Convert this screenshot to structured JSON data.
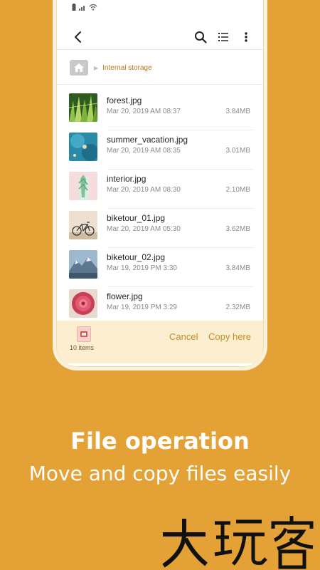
{
  "breadcrumb": {
    "location": "Internal storage"
  },
  "files": [
    {
      "name": "forest.jpg",
      "date": "Mar 20, 2019 AM 08:37",
      "size": "3.84MB",
      "thumb": "forest"
    },
    {
      "name": "summer_vacation.jpg",
      "date": "Mar 20, 2019 AM 08:35",
      "size": "3.01MB",
      "thumb": "water"
    },
    {
      "name": "interior.jpg",
      "date": "Mar 20, 2019 AM 08:30",
      "size": "2.10MB",
      "thumb": "interior"
    },
    {
      "name": "biketour_01.jpg",
      "date": "Mar 20, 2019 AM 05:30",
      "size": "3.62MB",
      "thumb": "bike"
    },
    {
      "name": "biketour_02.jpg",
      "date": "Mar 19, 2019 PM 3:30",
      "size": "3.84MB",
      "thumb": "mountain"
    },
    {
      "name": "flower.jpg",
      "date": "Mar 19, 2019 PM 3:29",
      "size": "2.32MB",
      "thumb": "flower"
    }
  ],
  "bottom_bar": {
    "item_count": "10 items",
    "cancel_label": "Cancel",
    "copy_label": "Copy here"
  },
  "promo": {
    "headline": "File operation",
    "subline": "Move and copy files easily"
  },
  "watermark_text": "大玩客",
  "colors": {
    "background": "#E3A136",
    "accent": "#C8892A",
    "bottom_bar": "#FCEFCF"
  },
  "icons": [
    "back-icon",
    "search-icon",
    "list-view-icon",
    "more-options-icon",
    "home-icon",
    "clipboard-icon"
  ]
}
